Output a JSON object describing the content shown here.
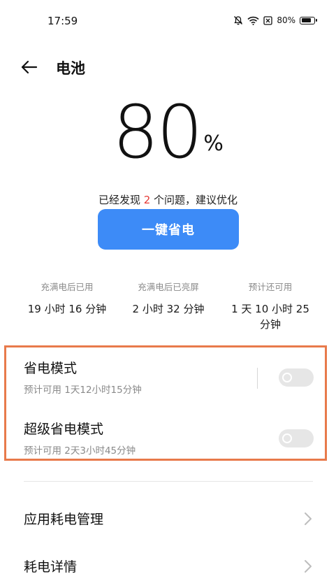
{
  "status_bar": {
    "time": "17:59",
    "battery_text": "80%",
    "battery_level": 0.8,
    "icons": [
      "mute-bell-icon",
      "wifi-icon",
      "sim-off-icon",
      "battery-icon"
    ]
  },
  "header": {
    "back_icon": "arrow-left-icon",
    "title": "电池"
  },
  "battery": {
    "percent_value": "80",
    "percent_sign": "%"
  },
  "issues": {
    "prefix": "已经发现 ",
    "count": "2",
    "suffix": " 个问题，建议优化"
  },
  "optimize_button": {
    "label": "一键省电"
  },
  "stats": [
    {
      "label": "充满电后已用",
      "value": "19 小时 16 分钟"
    },
    {
      "label": "充满电后已亮屏",
      "value": "2 小时 32 分钟"
    },
    {
      "label": "预计还可用",
      "value_line1": "1 天 10 小时 25",
      "value_line2": "分钟"
    }
  ],
  "modes": [
    {
      "title": "省电模式",
      "subtitle": "预计可用 1天12小时15分钟",
      "enabled": false
    },
    {
      "title": "超级省电模式",
      "subtitle": "预计可用 2天3小时45分钟",
      "enabled": false
    }
  ],
  "list": [
    {
      "label": "应用耗电管理",
      "icon": "chevron-right-icon"
    },
    {
      "label": "耗电详情",
      "icon": "chevron-right-icon"
    }
  ],
  "colors": {
    "accent_blue": "#3d8bf7",
    "highlight_orange": "#e87a4b",
    "issue_red": "#e53935",
    "toggle_off": "#e6e6e6"
  }
}
